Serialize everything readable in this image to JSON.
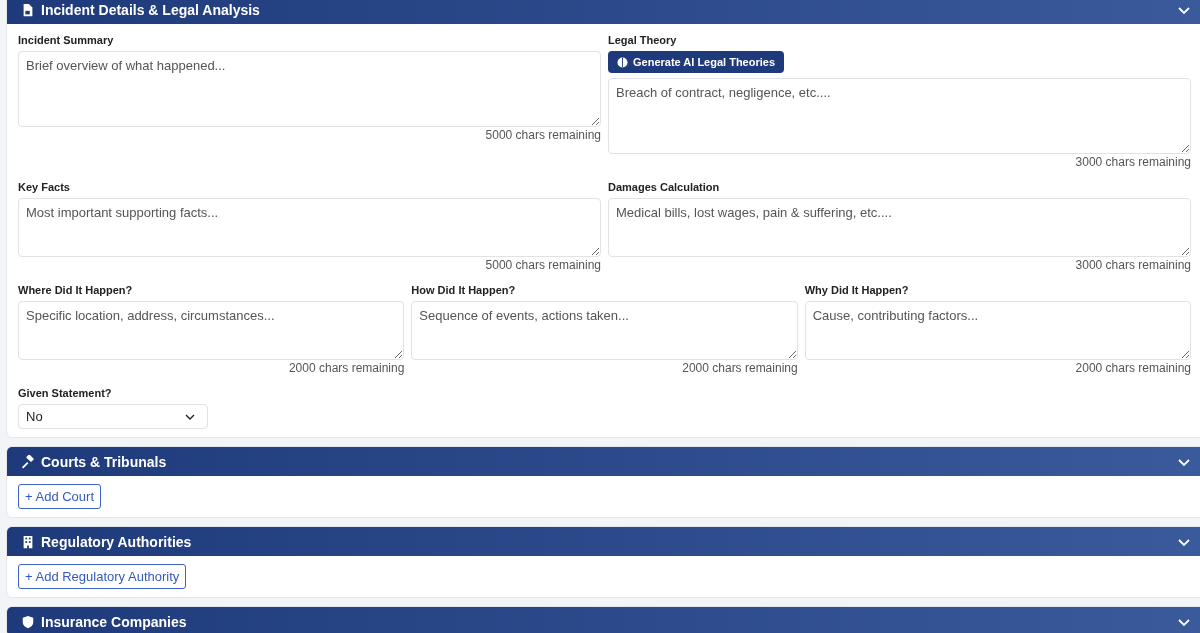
{
  "sections": [
    {
      "kind": "form",
      "title": "Incident Details & Legal Analysis",
      "rows": [
        {
          "fields": [
            {
              "kind": "textarea",
              "label": "Incident Summary",
              "placeholder": "Brief overview of what happened...",
              "counter": "5000 chars remaining"
            },
            {
              "kind": "textarea",
              "label": "Legal Theory",
              "action": "Generate AI Legal Theories",
              "placeholder": "Breach of contract, negligence, etc....",
              "counter": "3000 chars remaining"
            }
          ]
        },
        {
          "fields": [
            {
              "kind": "textarea",
              "label": "Key Facts",
              "placeholder": "Most important supporting facts...",
              "counter": "5000 chars remaining"
            },
            {
              "kind": "textarea",
              "label": "Damages Calculation",
              "placeholder": "Medical bills, lost wages, pain & suffering, etc....",
              "counter": "3000 chars remaining"
            }
          ]
        },
        {
          "fields": [
            {
              "kind": "textarea",
              "label": "Where Did It Happen?",
              "placeholder": "Specific location, address, circumstances...",
              "counter": "2000 chars remaining"
            },
            {
              "kind": "textarea",
              "label": "How Did It Happen?",
              "placeholder": "Sequence of events, actions taken...",
              "counter": "2000 chars remaining"
            },
            {
              "kind": "textarea",
              "label": "Why Did It Happen?",
              "placeholder": "Cause, contributing factors...",
              "counter": "2000 chars remaining"
            }
          ]
        },
        {
          "fields": [
            {
              "kind": "select",
              "label": "Given Statement?",
              "value": "No"
            }
          ]
        }
      ]
    },
    {
      "kind": "list",
      "title": "Courts & Tribunals",
      "add_button": "+ Add Court"
    },
    {
      "kind": "list",
      "title": "Regulatory Authorities",
      "add_button": "+ Add Regulatory Authority"
    },
    {
      "kind": "list",
      "title": "Insurance Companies"
    }
  ]
}
